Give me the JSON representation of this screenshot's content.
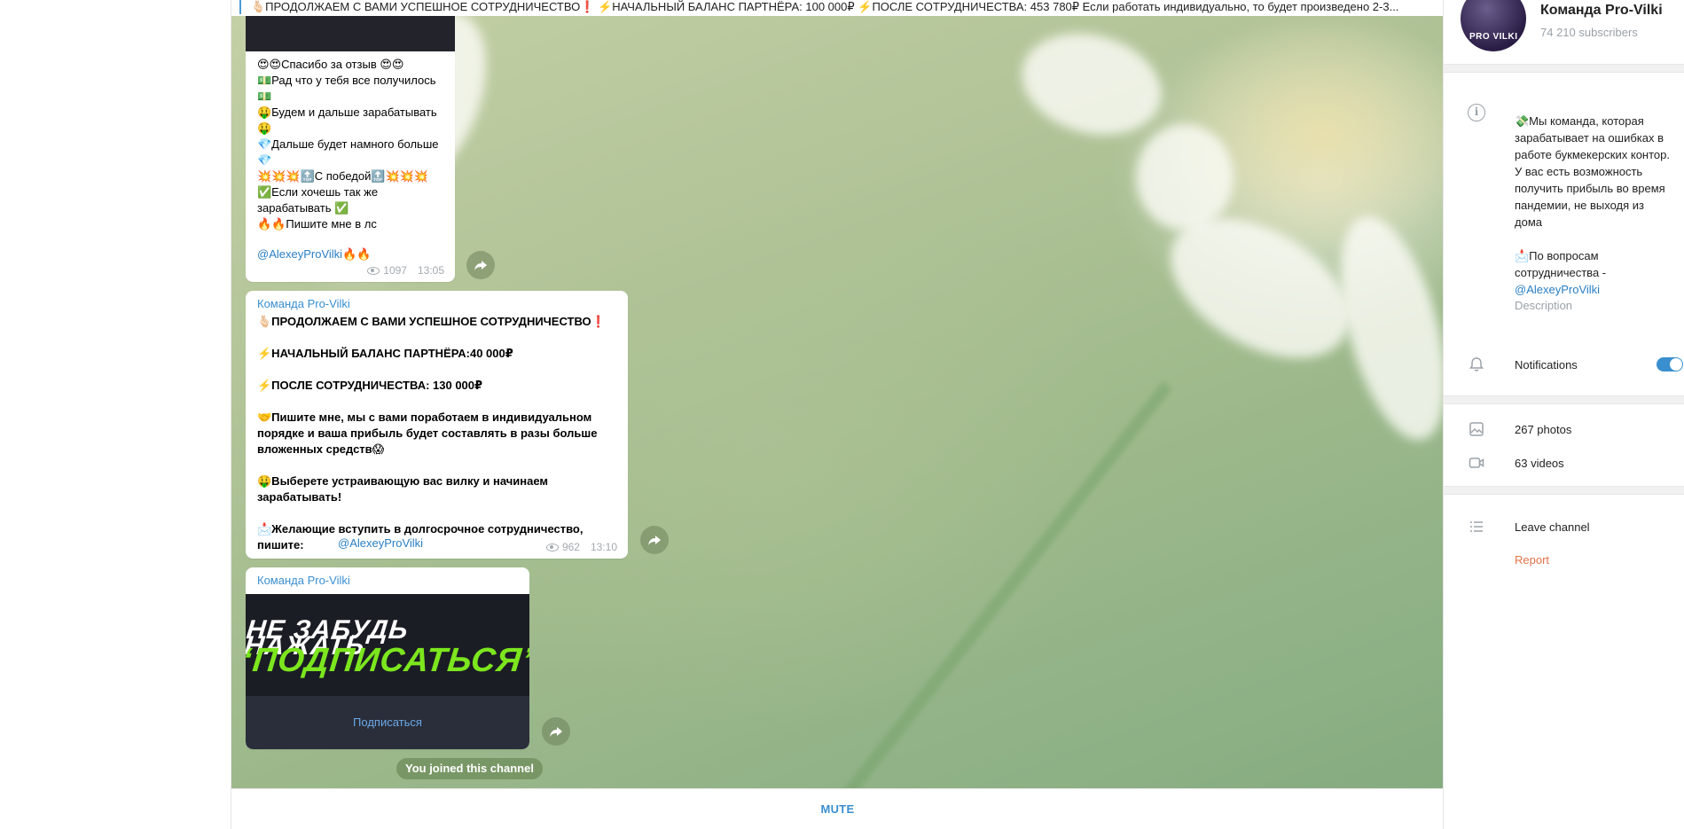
{
  "pinned": {
    "text": "🫰🏻ПРОДОЛЖАЕМ С ВАМИ УСПЕШНОЕ СОТРУДНИЧЕСТВО❗️ ⚡️НАЧАЛЬНЫЙ БАЛАНС ПАРТНЁРА: 100 000₽ ⚡️ПОСЛЕ СОТРУДНИЧЕСТВА: 453 780₽  Если работать индивидуально, то будет произведено 2-3..."
  },
  "messages": [
    {
      "text": "😍😍Спасибо за отзыв 😍😍\n💵Рад что у тебя все получилось 💵\n🤑Будем и дальше зарабатывать 🤑\n💎Дальше будет намного больше💎\n💥💥💥🔝С победой🔝💥💥💥\n✅Если хочешь так же зарабатывать ✅\n🔥🔥Пишите мне в лс",
      "link": "@AlexeyProVilki",
      "link_suffix": "🔥🔥",
      "views": "1097",
      "time": "13:05"
    },
    {
      "author": "Команда Pro-Vilki",
      "text": "🫰🏻ПРОДОЛЖАЕМ С ВАМИ УСПЕШНОЕ СОТРУДНИЧЕСТВО❗️\n\n⚡️НАЧАЛЬНЫЙ БАЛАНС ПАРТНЁРА:40 000₽\n\n⚡️ПОСЛЕ СОТРУДНИЧЕСТВА: 130 000₽\n\n🤝Пишите мне, мы с вами поработаем в индивидуальном порядке и ваша  прибыль будет составлять в разы  больше вложенных средств😱\n\n🤑Выберете устраивающую вас вилку и начинаем зарабатывать!\n\n📩Желающие вступить в долгосрочное сотрудничество, пишите:",
      "link": "@AlexeyProVilki",
      "views": "962",
      "time": "13:10"
    },
    {
      "author": "Команда Pro-Vilki",
      "banner_line1": "НЕ ЗАБУДЬ НАЖАТЬ",
      "banner_line2": "“ПОДПИСАТЬСЯ”",
      "button": "Подписаться"
    }
  ],
  "joined_label": "You joined this channel",
  "composer": {
    "mute_label": "MUTE"
  },
  "channel": {
    "title": "Команда Pro-Vilki",
    "subscribers": "74 210 subscribers",
    "avatar_text": "PRO VILKI",
    "description": "💸Мы команда, которая зарабатывает на ошибках в работе букмекерских контор. У вас есть возможность получить прибыль во время пандемии, не выходя из дома\n\n📩По вопросам сотрудничества -",
    "description_link": "@AlexeyProVilki",
    "description_caption": "Description",
    "notifications_label": "Notifications",
    "notifications_on": true,
    "photos": "267 photos",
    "videos": "63 videos",
    "leave_label": "Leave channel",
    "report_label": "Report"
  },
  "colors": {
    "accent": "#3a8fcf",
    "report": "#e0744a",
    "banner_green": "#7ce61e"
  }
}
